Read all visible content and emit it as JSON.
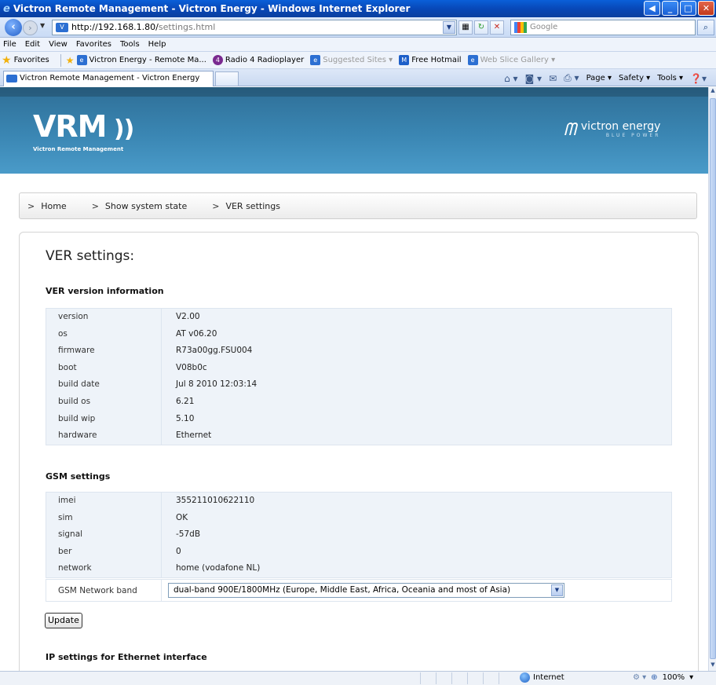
{
  "window": {
    "title": "Victron Remote Management - Victron Energy - Windows Internet Explorer"
  },
  "address": {
    "url_host": "http://192.168.1.80/",
    "url_path": "settings.html",
    "search_placeholder": "Google"
  },
  "menu": [
    "File",
    "Edit",
    "View",
    "Favorites",
    "Tools",
    "Help"
  ],
  "favorites": {
    "label": "Favorites",
    "items": [
      "Victron Energy - Remote Ma...",
      "Radio 4 Radioplayer",
      "Suggested Sites ▾",
      "Free Hotmail",
      "Web Slice Gallery ▾"
    ]
  },
  "tab": {
    "title": "Victron Remote Management - Victron Energy"
  },
  "commands": [
    "Page ▾",
    "Safety ▾",
    "Tools ▾"
  ],
  "header": {
    "logo": "VRM",
    "logo_sub": "Victron Remote Management",
    "brand": "victron energy",
    "brand_tag": "BLUE POWER"
  },
  "breadcrumb": [
    "Home",
    "Show system state",
    "VER settings"
  ],
  "page": {
    "title": "VER settings:",
    "version_section": "VER version information",
    "version_rows": [
      {
        "k": "version",
        "v": "V2.00"
      },
      {
        "k": "os",
        "v": "AT v06.20"
      },
      {
        "k": "firmware",
        "v": "R73a00gg.FSU004"
      },
      {
        "k": "boot",
        "v": "V08b0c"
      },
      {
        "k": "build date",
        "v": "Jul 8 2010 12:03:14"
      },
      {
        "k": "build os",
        "v": "6.21"
      },
      {
        "k": "build wip",
        "v": "5.10"
      },
      {
        "k": "hardware",
        "v": "Ethernet"
      }
    ],
    "gsm_section": "GSM settings",
    "gsm_rows": [
      {
        "k": "imei",
        "v": "355211010622110"
      },
      {
        "k": "sim",
        "v": "OK"
      },
      {
        "k": "signal",
        "v": "-57dB"
      },
      {
        "k": "ber",
        "v": "0"
      },
      {
        "k": "network",
        "v": "home (vodafone NL)"
      }
    ],
    "band_label": "GSM Network band",
    "band_value": "dual-band 900E/1800MHz (Europe, Middle East, Africa, Oceania and most of Asia)",
    "update_label": "Update",
    "ip_section": "IP settings for Ethernet interface"
  },
  "status": {
    "zone": "Internet",
    "zoom": "100%"
  }
}
